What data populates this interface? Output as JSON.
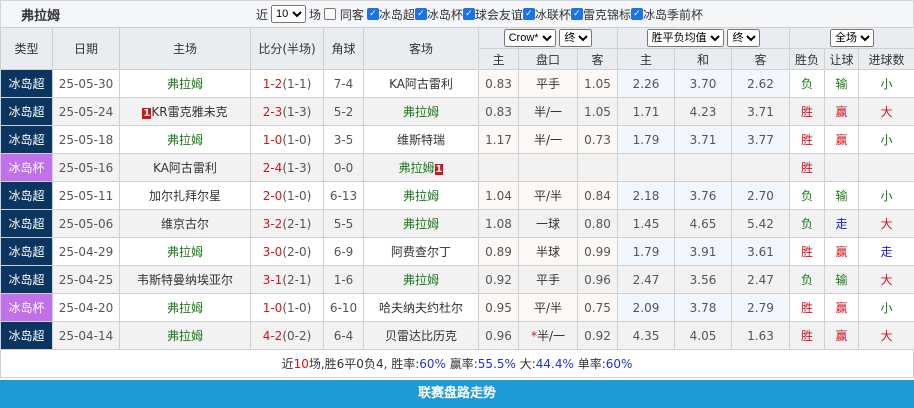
{
  "header": {
    "title": "弗拉姆",
    "recent_label": "近",
    "recent_value": "10",
    "unit_label": "场",
    "same_label": "同客",
    "filters": [
      "冰岛超",
      "冰岛杯",
      "球会友谊",
      "冰联杯",
      "雷克锦标",
      "冰岛季前杯"
    ]
  },
  "columns": {
    "type": "类型",
    "date": "日期",
    "home": "主场",
    "score": "比分(半场)",
    "corner": "角球",
    "away": "客场",
    "company": "Crow*",
    "asian_time": "终",
    "euro_select": "胜平负均值",
    "euro_time": "终",
    "scope": "全场",
    "as_home": "主",
    "as_line": "盘口",
    "as_away": "客",
    "eu_home": "主",
    "eu_draw": "和",
    "eu_away": "客",
    "wl": "胜负",
    "hcap": "让球",
    "goals": "进球数"
  },
  "colors": {
    "league": "#0a3561",
    "cup": "#c070e8",
    "team": "#1a7a1a",
    "win": "#d0141e",
    "lose": "#1a7a1a",
    "push": "#1a1ad0"
  },
  "rows": [
    {
      "type": "冰岛超",
      "cup": false,
      "date": "25-05-30",
      "home": "弗拉姆",
      "hf": true,
      "hc": "",
      "ft": "1-2",
      "ht": "(1-1)",
      "corner": "7-4",
      "away": "KA阿古雷利",
      "af": false,
      "ac": "",
      "ah": "0.83",
      "line": "平手",
      "star": "",
      "aa": "1.05",
      "eh": "2.26",
      "ed": "3.70",
      "ea": "2.62",
      "wl": "负",
      "hcap": "输",
      "goals": "小"
    },
    {
      "type": "冰岛超",
      "cup": false,
      "date": "25-05-24",
      "home": "KR雷克雅未克",
      "hf": false,
      "hc": "1",
      "ft": "2-3",
      "ht": "(1-3)",
      "corner": "5-2",
      "away": "弗拉姆",
      "af": true,
      "ac": "",
      "ah": "0.83",
      "line": "半/一",
      "star": "",
      "aa": "1.05",
      "eh": "1.71",
      "ed": "4.23",
      "ea": "3.71",
      "wl": "胜",
      "hcap": "赢",
      "goals": "大"
    },
    {
      "type": "冰岛超",
      "cup": false,
      "date": "25-05-18",
      "home": "弗拉姆",
      "hf": true,
      "hc": "",
      "ft": "1-0",
      "ht": "(1-0)",
      "corner": "3-5",
      "away": "维斯特瑞",
      "af": false,
      "ac": "",
      "ah": "1.17",
      "line": "半/一",
      "star": "",
      "aa": "0.73",
      "eh": "1.79",
      "ed": "3.71",
      "ea": "3.77",
      "wl": "胜",
      "hcap": "赢",
      "goals": "小"
    },
    {
      "type": "冰岛杯",
      "cup": true,
      "date": "25-05-16",
      "home": "KA阿古雷利",
      "hf": false,
      "hc": "",
      "ft": "2-4",
      "ht": "(1-3)",
      "corner": "0-0",
      "away": "弗拉姆",
      "af": true,
      "ac": "1",
      "ah": "",
      "line": "",
      "star": "",
      "aa": "",
      "eh": "",
      "ed": "",
      "ea": "",
      "wl": "胜",
      "hcap": "",
      "goals": ""
    },
    {
      "type": "冰岛超",
      "cup": false,
      "date": "25-05-11",
      "home": "加尔扎拜尔星",
      "hf": false,
      "hc": "",
      "ft": "2-0",
      "ht": "(1-0)",
      "corner": "6-13",
      "away": "弗拉姆",
      "af": true,
      "ac": "",
      "ah": "1.04",
      "line": "平/半",
      "star": "",
      "aa": "0.84",
      "eh": "2.18",
      "ed": "3.76",
      "ea": "2.70",
      "wl": "负",
      "hcap": "输",
      "goals": "小"
    },
    {
      "type": "冰岛超",
      "cup": false,
      "date": "25-05-06",
      "home": "维京古尔",
      "hf": false,
      "hc": "",
      "ft": "3-2",
      "ht": "(2-1)",
      "corner": "5-5",
      "away": "弗拉姆",
      "af": true,
      "ac": "",
      "ah": "1.08",
      "line": "一球",
      "star": "",
      "aa": "0.80",
      "eh": "1.45",
      "ed": "4.65",
      "ea": "5.42",
      "wl": "负",
      "hcap": "走",
      "goals": "大"
    },
    {
      "type": "冰岛超",
      "cup": false,
      "date": "25-04-29",
      "home": "弗拉姆",
      "hf": true,
      "hc": "",
      "ft": "3-0",
      "ht": "(2-0)",
      "corner": "6-9",
      "away": "阿费查尔丁",
      "af": false,
      "ac": "",
      "ah": "0.89",
      "line": "半球",
      "star": "",
      "aa": "0.99",
      "eh": "1.79",
      "ed": "3.91",
      "ea": "3.61",
      "wl": "胜",
      "hcap": "赢",
      "goals": "走"
    },
    {
      "type": "冰岛超",
      "cup": false,
      "date": "25-04-25",
      "home": "韦斯特曼纳埃亚尔",
      "hf": false,
      "hc": "",
      "ft": "3-1",
      "ht": "(2-1)",
      "corner": "1-6",
      "away": "弗拉姆",
      "af": true,
      "ac": "",
      "ah": "0.92",
      "line": "平手",
      "star": "",
      "aa": "0.96",
      "eh": "2.47",
      "ed": "3.56",
      "ea": "2.47",
      "wl": "负",
      "hcap": "输",
      "goals": "大"
    },
    {
      "type": "冰岛杯",
      "cup": true,
      "date": "25-04-20",
      "home": "弗拉姆",
      "hf": true,
      "hc": "",
      "ft": "1-0",
      "ht": "(1-0)",
      "corner": "6-10",
      "away": "哈夫纳夫约杜尔",
      "af": false,
      "ac": "",
      "ah": "0.95",
      "line": "平/半",
      "star": "",
      "aa": "0.75",
      "eh": "2.09",
      "ed": "3.78",
      "ea": "2.79",
      "wl": "胜",
      "hcap": "赢",
      "goals": "小"
    },
    {
      "type": "冰岛超",
      "cup": false,
      "date": "25-04-14",
      "home": "弗拉姆",
      "hf": true,
      "hc": "",
      "ft": "4-2",
      "ht": "(0-2)",
      "corner": "6-4",
      "away": "贝雷达比历克",
      "af": false,
      "ac": "",
      "ah": "0.96",
      "line": "半/一",
      "star": "*",
      "aa": "0.92",
      "eh": "4.35",
      "ed": "4.05",
      "ea": "1.63",
      "wl": "胜",
      "hcap": "赢",
      "goals": "大"
    }
  ],
  "summary": {
    "p1": "近",
    "n": "10",
    "p2": "场,胜6平0负4, 胜率:",
    "win": "60%",
    "p3": " 赢率:",
    "cover": "55.5%",
    "p4": " 大:",
    "over": "44.4%",
    "p5": " 单率:",
    "odd": "60%"
  },
  "footer": {
    "label": "联赛盘路走势"
  }
}
